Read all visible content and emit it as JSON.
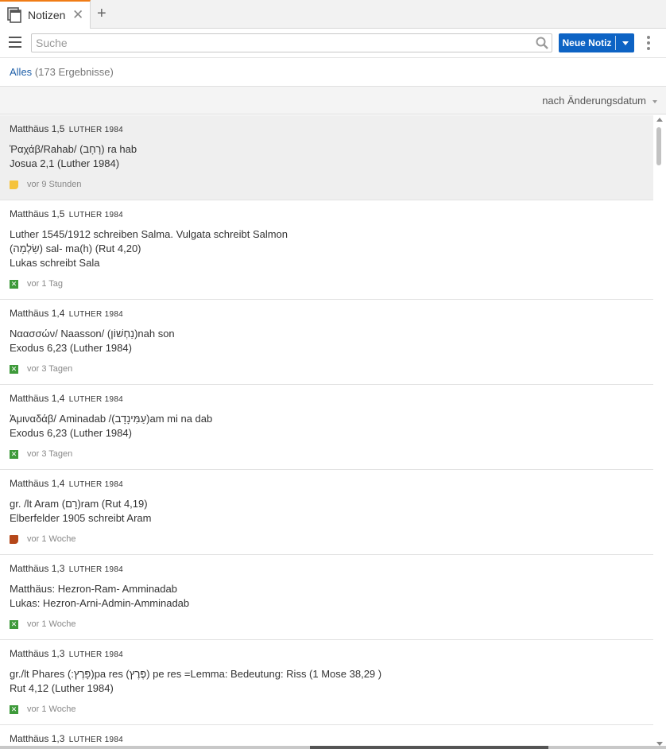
{
  "tab": {
    "title": "Notizen",
    "close_glyph": "✕",
    "add_glyph": "+",
    "icon": "notes-icon"
  },
  "toolbar": {
    "search_placeholder": "Suche",
    "search_value": "",
    "new_note_label": "Neue Notiz"
  },
  "filter": {
    "label": "Alles",
    "count": "(173 Ergebnisse)"
  },
  "sort": {
    "label": "nach Änderungsdatum"
  },
  "colors": {
    "accent": "#0d63c4",
    "tab_accent": "#f07c16",
    "link": "#1f5fa8",
    "marker_yellow": "#f5c33c",
    "marker_green": "#3e9a3a",
    "marker_brown": "#b5471a"
  },
  "notes": [
    {
      "ref": "Matthäus 1,5",
      "version": "LUTHER 1984",
      "lines": [
        "Ῥαχάβ/Rahab/ (רָחָב) ra hab",
        "Josua 2,1 (Luther 1984)"
      ],
      "marker": "yellow",
      "time": "vor 9 Stunden",
      "selected": true
    },
    {
      "ref": "Matthäus 1,5",
      "version": "LUTHER 1984",
      "lines": [
        "Luther 1545/1912 schreiben Salma. Vulgata schreibt Salmon",
        "(שַׂלְמָה) sal- ma(h) (Rut 4,20)",
        "Lukas schreibt Sala"
      ],
      "marker": "x",
      "time": "vor 1 Tag"
    },
    {
      "ref": "Matthäus 1,4",
      "version": "LUTHER 1984",
      "lines": [
        "Ναασσών/ Naasson/ (נַחְשׁוֹן)nah son",
        "Exodus 6,23 (Luther 1984)"
      ],
      "marker": "x",
      "time": "vor 3 Tagen"
    },
    {
      "ref": "Matthäus 1,4",
      "version": "LUTHER 1984",
      "lines": [
        "Ἀμιναδάβ/ Aminadab /(עַמִּינָדָב)am mi na dab",
        "Exodus 6,23 (Luther 1984)"
      ],
      "marker": "x",
      "time": "vor 3 Tagen"
    },
    {
      "ref": "Matthäus 1,4",
      "version": "LUTHER 1984",
      "lines": [
        "gr. /lt Aram (רָם)ram (Rut 4,19)",
        "Elberfelder 1905 schreibt Aram"
      ],
      "marker": "brown",
      "time": "vor 1 Woche"
    },
    {
      "ref": "Matthäus 1,3",
      "version": "LUTHER 1984",
      "lines": [
        "Matthäus: Hezron-Ram- Amminadab",
        "Lukas: Hezron-Arni-Admin-Amminadab"
      ],
      "marker": "x",
      "time": "vor 1 Woche"
    },
    {
      "ref": "Matthäus 1,3",
      "version": "LUTHER 1984",
      "lines": [
        "gr./lt Phares (:פָּרֶץ)pa res (פֶּרֶץ) pe res =Lemma: Bedeutung: Riss (1 Mose 38,29 )",
        "Rut 4,12 (Luther 1984)"
      ],
      "marker": "x",
      "time": "vor 1 Woche"
    },
    {
      "ref": "Matthäus 1,3",
      "version": "LUTHER 1984",
      "lines": [],
      "marker": "none",
      "time": ""
    }
  ]
}
